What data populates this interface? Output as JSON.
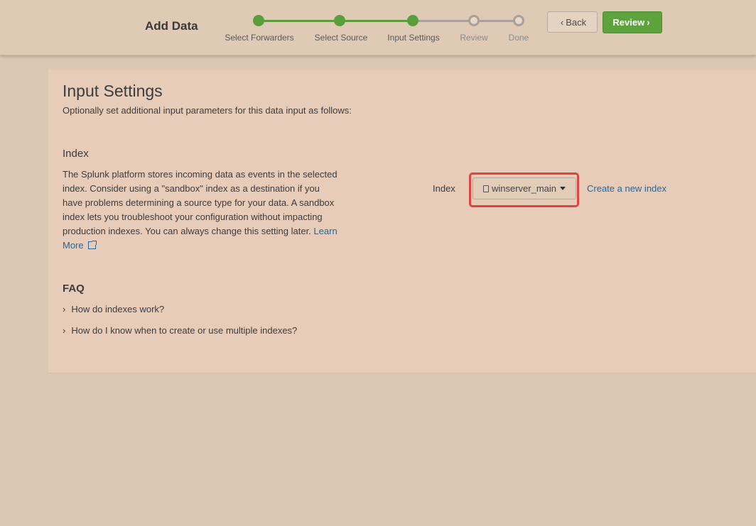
{
  "header": {
    "title": "Add Data",
    "steps": [
      {
        "label": "Select Forwarders",
        "status": "done"
      },
      {
        "label": "Select Source",
        "status": "done"
      },
      {
        "label": "Input Settings",
        "status": "done"
      },
      {
        "label": "Review",
        "status": "todo"
      },
      {
        "label": "Done",
        "status": "todo"
      }
    ],
    "back_label": "Back",
    "review_label": "Review",
    "back_chevron": "‹",
    "review_chevron": "›"
  },
  "main": {
    "title": "Input Settings",
    "subtitle": "Optionally set additional input parameters for this data input as follows:",
    "index_section": {
      "heading": "Index",
      "description": "The Splunk platform stores incoming data as events in the selected index. Consider using a \"sandbox\" index as a destination if you have problems determining a source type for your data. A sandbox index lets you troubleshoot your configuration without impacting production indexes. You can always change this setting later.",
      "learn_more": "Learn More",
      "field_label": "Index",
      "selected_value": "winserver_main",
      "create_link": "Create a new index"
    },
    "faq": {
      "heading": "FAQ",
      "items": [
        "How do indexes work?",
        "How do I know when to create or use multiple indexes?"
      ]
    }
  },
  "colors": {
    "accent_green": "#5ea23e",
    "link_blue": "#1a6aa5",
    "highlight_red": "#e0443e"
  }
}
